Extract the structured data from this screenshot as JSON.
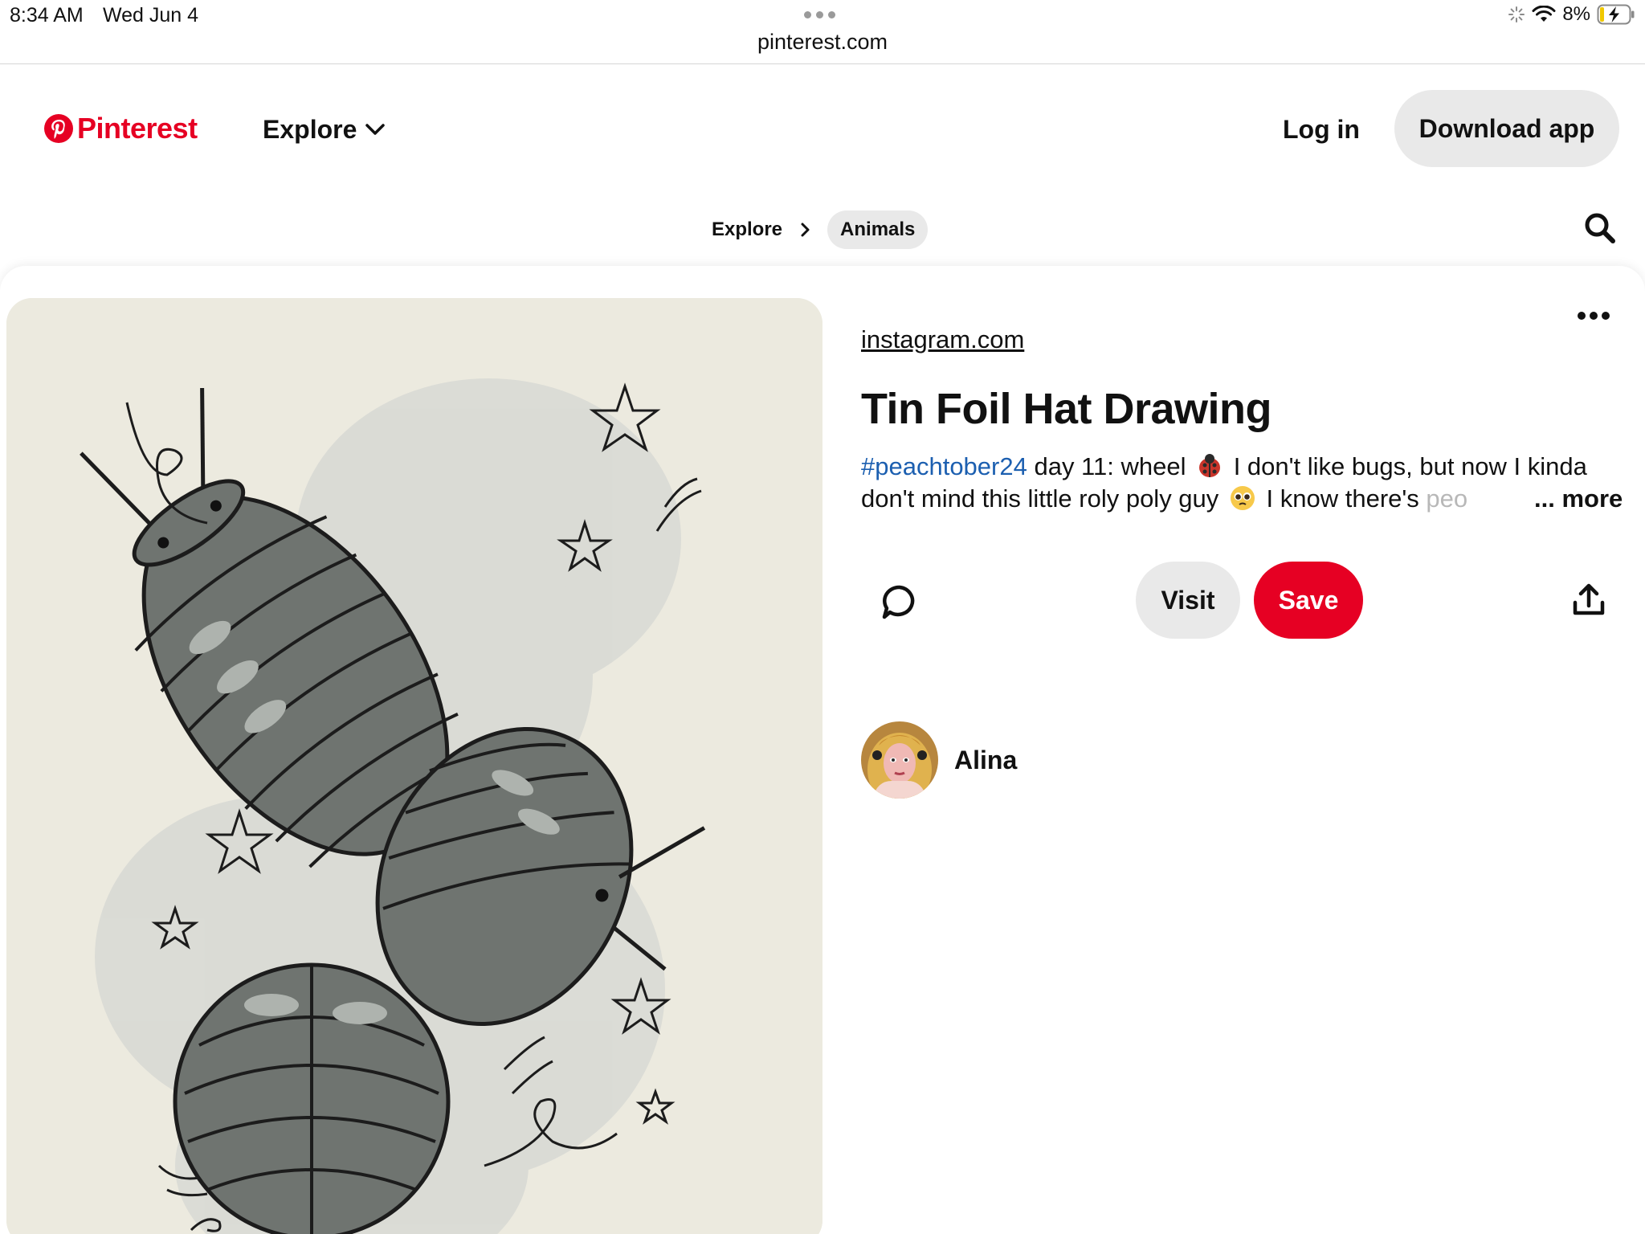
{
  "status_bar": {
    "time": "8:34 AM",
    "date": "Wed Jun 4",
    "url": "pinterest.com",
    "battery_percent": "8%",
    "icons": [
      "activity-spinner-icon",
      "wifi-icon",
      "battery-charging-icon"
    ]
  },
  "header": {
    "logo_text": "Pinterest",
    "explore_label": "Explore",
    "login_label": "Log in",
    "download_label": "Download app"
  },
  "breadcrumb": {
    "items": [
      {
        "label": "Explore"
      },
      {
        "label": "Animals"
      }
    ]
  },
  "pin": {
    "source": "instagram.com",
    "title": "Tin Foil Hat Drawing",
    "description": {
      "hashtag": "#peachtober24",
      "part1": " day 11: wheel ",
      "part2": " I don't like bugs, but now I kinda don't mind this little roly poly guy ",
      "part3": " I know there's ",
      "faded": "peo"
    },
    "more_label": "... more",
    "visit_label": "Visit",
    "save_label": "Save",
    "creator_name": "Alina"
  },
  "colors": {
    "brand_red": "#e60023",
    "button_gray": "#e9e9e9",
    "hashtag_blue": "#1c5fb0",
    "text": "#111111"
  }
}
